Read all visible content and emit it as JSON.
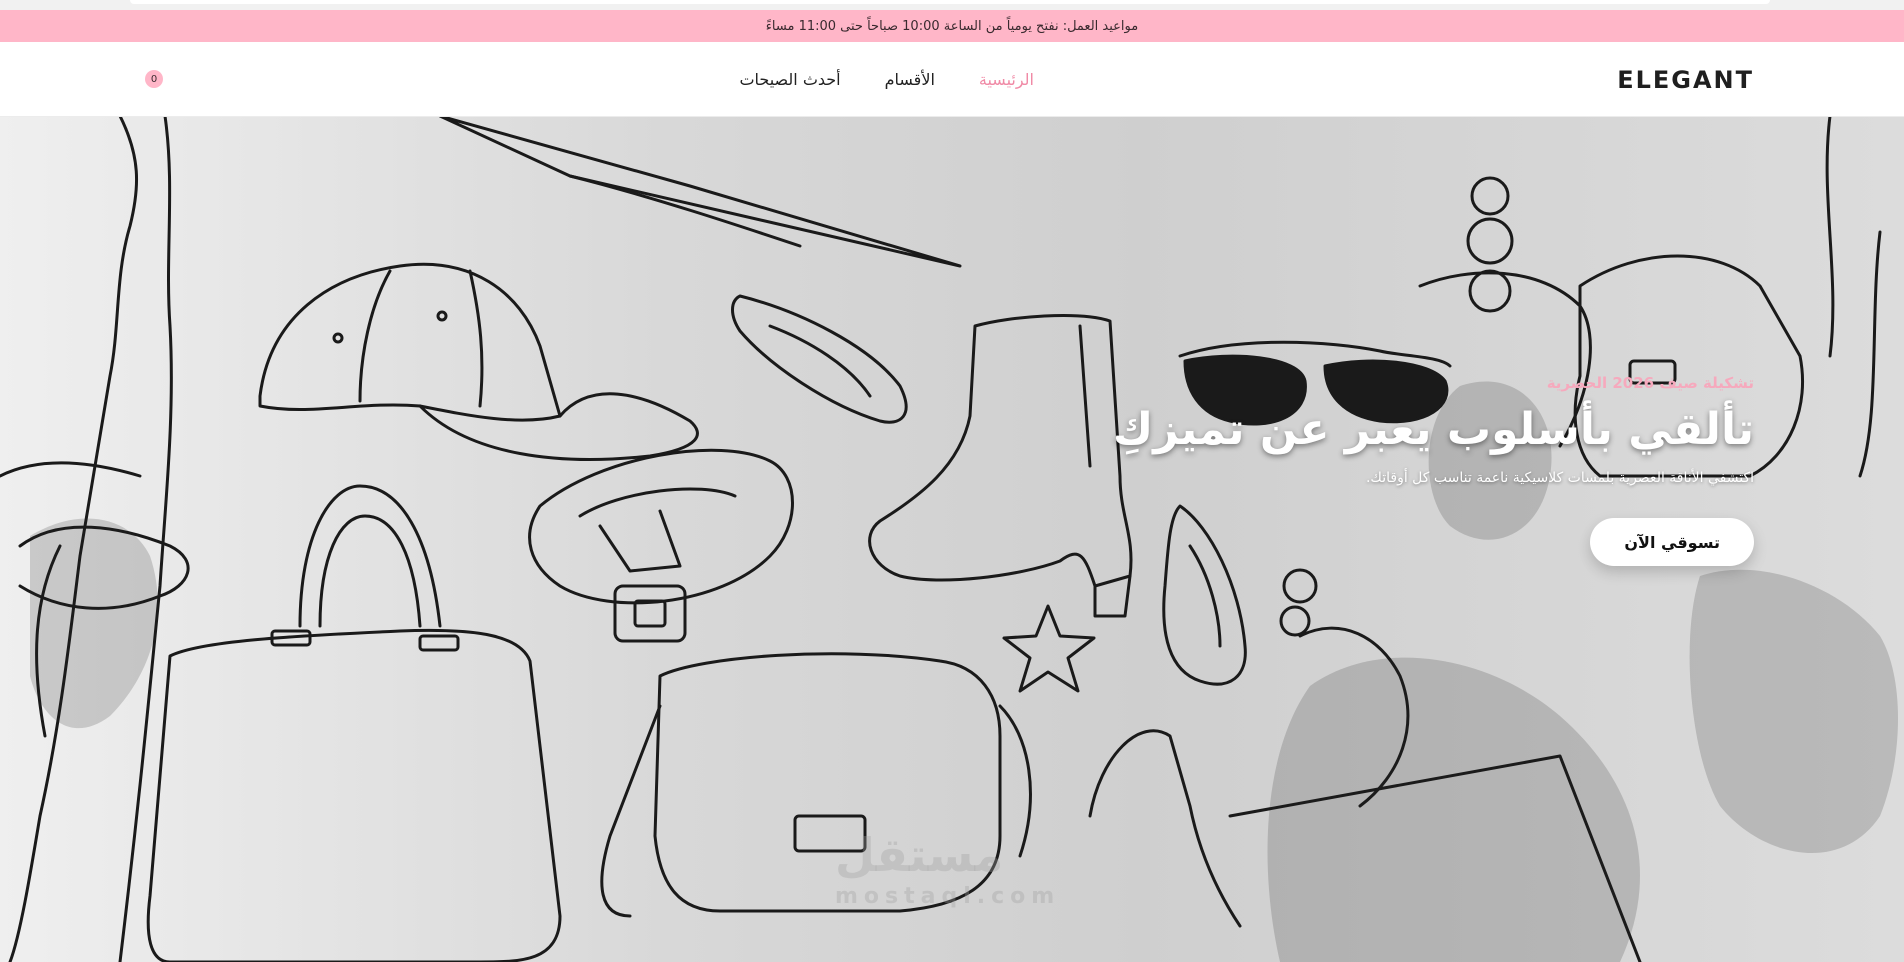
{
  "announcement": {
    "text": "مواعيد العمل: نفتح يومياً من الساعة 10:00 صباحاً حتى 11:00 مساءً"
  },
  "header": {
    "logo": "ELEGANT",
    "nav": [
      "الرئيسية",
      "الأقسام",
      "أحدث الصيحات"
    ],
    "cart_count": "0"
  },
  "hero": {
    "eyebrow": "تشكيلة صيف 2026 الحصرية",
    "title": "تألقي بأسلوب يعبر عن تميزكِ",
    "subtitle": "اكتشفي الأناقة العصرية بلمسات كلاسيكية ناعمة تناسب كل أوقاتك.",
    "cta_label": "تسوقي الآن"
  },
  "watermark": {
    "main": "مستقل",
    "sub": "mostaql.com"
  },
  "colors": {
    "accent": "#ffb6c8",
    "active_link": "#f08aa6"
  },
  "icons": {
    "cart": "cart-badge"
  }
}
